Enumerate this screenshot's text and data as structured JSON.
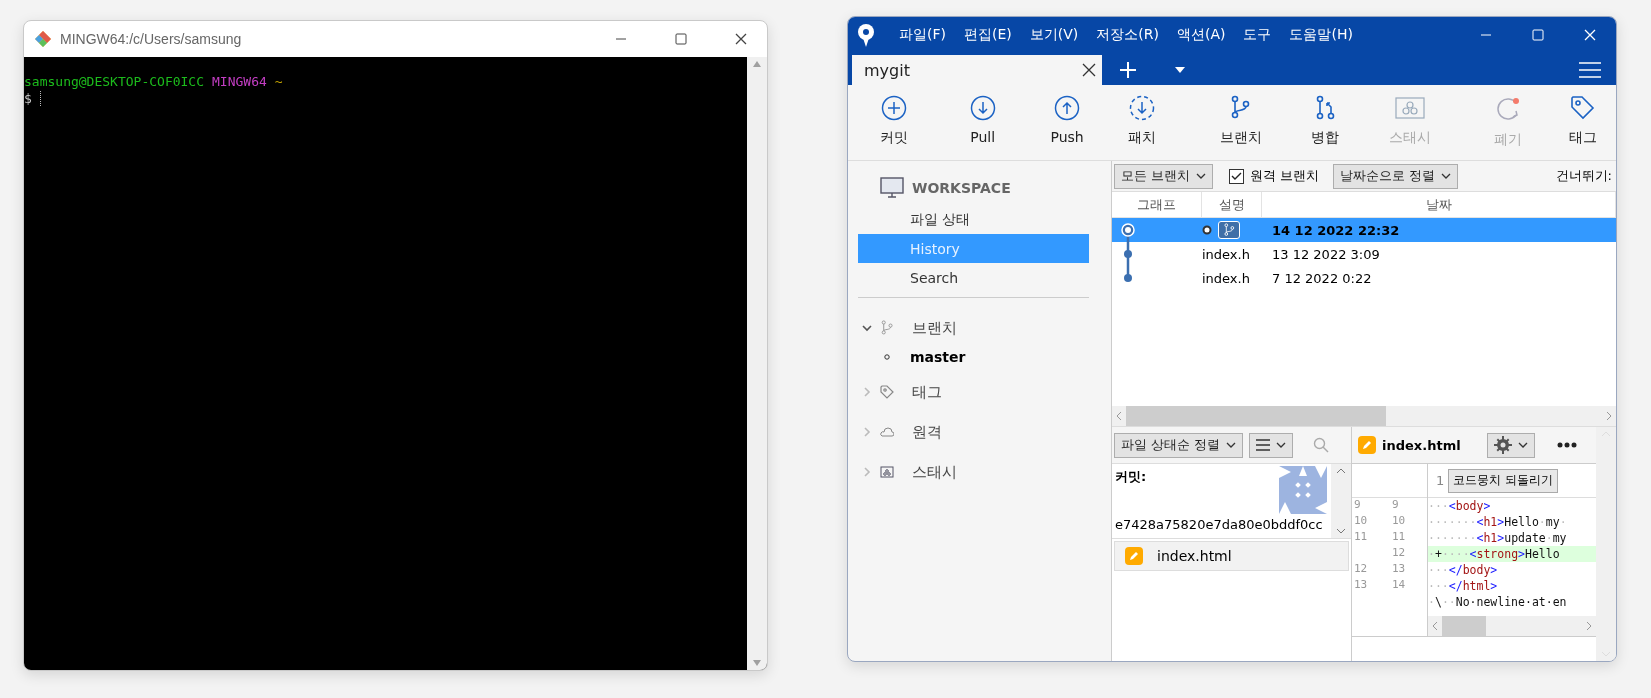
{
  "terminal": {
    "title": "MINGW64:/c/Users/samsung",
    "lines": [
      {
        "parts": [
          {
            "text": "samsung@DESKTOP-COF0ICC",
            "kind": "user"
          },
          {
            "text": "MINGW64",
            "kind": "system"
          },
          {
            "text": "~",
            "kind": "path"
          }
        ]
      },
      {
        "parts": [
          {
            "text": "$",
            "kind": "plain"
          }
        ],
        "cursor": true
      }
    ]
  },
  "sourcetree": {
    "menu": [
      "파일(F)",
      "편집(E)",
      "보기(V)",
      "저장소(R)",
      "액션(A)",
      "도구",
      "도움말(H)"
    ],
    "tabs": [
      {
        "label": "mygit",
        "selected": true
      }
    ],
    "toolbar": [
      {
        "label": "커밋",
        "kind": "commit",
        "disabled": false
      },
      {
        "label": "Pull",
        "kind": "pull",
        "disabled": false
      },
      {
        "label": "Push",
        "kind": "push",
        "disabled": false
      },
      {
        "label": "패치",
        "kind": "fetch",
        "disabled": false
      },
      {
        "label": "브랜치",
        "kind": "branch",
        "disabled": false
      },
      {
        "label": "병합",
        "kind": "merge",
        "disabled": false
      },
      {
        "label": "스태시",
        "kind": "stash",
        "disabled": true
      },
      {
        "label": "폐기",
        "kind": "discard",
        "disabled": true
      },
      {
        "label": "태그",
        "kind": "tag",
        "disabled": false
      }
    ],
    "sidebar": {
      "workspace": "WORKSPACE",
      "items": [
        {
          "label": "파일 상태",
          "selected": false
        },
        {
          "label": "History",
          "selected": true
        },
        {
          "label": "Search",
          "selected": false
        }
      ],
      "groups": [
        {
          "label": "브랜치",
          "kind": "branch",
          "expanded": true,
          "children": [
            {
              "label": "master",
              "current": true
            }
          ]
        },
        {
          "label": "태그",
          "kind": "tag",
          "expanded": false
        },
        {
          "label": "원격",
          "kind": "remote",
          "expanded": false
        },
        {
          "label": "스태시",
          "kind": "stash",
          "expanded": false
        }
      ]
    },
    "history": {
      "branch_filter": "모든 브랜치",
      "remote_branches": {
        "label": "원격 브랜치",
        "checked": true
      },
      "sort": "날짜순으로 정렬",
      "jump": "건너뛰기:",
      "columns": [
        "그래프",
        "설명",
        "날짜"
      ],
      "rows": [
        {
          "head": true,
          "branch_badge": true,
          "description": "",
          "date": "14 12 2022 22:32",
          "selected": true
        },
        {
          "head": false,
          "branch_badge": false,
          "description": "index.h",
          "date": "13 12 2022 3:09",
          "selected": false
        },
        {
          "head": false,
          "branch_badge": false,
          "description": "index.h",
          "date": "7 12 2022 0:22",
          "selected": false
        }
      ]
    },
    "files": {
      "sort": "파일 상태순 정렬",
      "commit_label": "커밋:",
      "hash": "e7428a75820e7da80e0bddf0cc",
      "items": [
        {
          "name": "index.html",
          "selected": true
        }
      ]
    },
    "diff": {
      "file": "index.html",
      "hunk": "1",
      "revert": "코드뭉치 되돌리기",
      "lines": [
        {
          "old": "9",
          "new": "9",
          "kind": "context",
          "parts": [
            {
              "text": "···",
              "kind": "ws"
            },
            {
              "text": "<",
              "kind": "br"
            },
            {
              "text": "body",
              "kind": "tag"
            },
            {
              "text": ">",
              "kind": "br"
            }
          ]
        },
        {
          "old": "10",
          "new": "10",
          "kind": "context",
          "parts": [
            {
              "text": "·······",
              "kind": "ws"
            },
            {
              "text": "<",
              "kind": "br"
            },
            {
              "text": "h1",
              "kind": "tag"
            },
            {
              "text": ">",
              "kind": "br"
            },
            {
              "text": "Hello",
              "kind": "text"
            },
            {
              "text": "·",
              "kind": "ws"
            },
            {
              "text": "my",
              "kind": "text"
            },
            {
              "text": "·",
              "kind": "ws"
            }
          ]
        },
        {
          "old": "11",
          "new": "11",
          "kind": "context",
          "parts": [
            {
              "text": "·······",
              "kind": "ws"
            },
            {
              "text": "<",
              "kind": "br"
            },
            {
              "text": "h1",
              "kind": "tag"
            },
            {
              "text": ">",
              "kind": "br"
            },
            {
              "text": "update",
              "kind": "text"
            },
            {
              "text": "·",
              "kind": "ws"
            },
            {
              "text": "my",
              "kind": "text"
            }
          ]
        },
        {
          "new": "12",
          "kind": "added",
          "parts": [
            {
              "text": "·",
              "kind": "ws"
            },
            {
              "text": "+",
              "kind": "text"
            },
            {
              "text": "····",
              "kind": "ws"
            },
            {
              "text": "<",
              "kind": "br"
            },
            {
              "text": "strong",
              "kind": "tag"
            },
            {
              "text": ">",
              "kind": "br"
            },
            {
              "text": "Hello",
              "kind": "text"
            }
          ]
        },
        {
          "old": "12",
          "new": "13",
          "kind": "context",
          "parts": [
            {
              "text": "···",
              "kind": "ws"
            },
            {
              "text": "</",
              "kind": "br"
            },
            {
              "text": "body",
              "kind": "tag"
            },
            {
              "text": ">",
              "kind": "br"
            }
          ]
        },
        {
          "old": "13",
          "new": "14",
          "kind": "context",
          "parts": [
            {
              "text": "···",
              "kind": "ws"
            },
            {
              "text": "</",
              "kind": "br"
            },
            {
              "text": "html",
              "kind": "tag"
            },
            {
              "text": ">",
              "kind": "br"
            }
          ]
        },
        {
          "kind": "context",
          "parts": [
            {
              "text": "·",
              "kind": "ws"
            },
            {
              "text": "\\",
              "kind": "text"
            },
            {
              "text": "··",
              "kind": "ws"
            },
            {
              "text": "No·newline·at·en",
              "kind": "text"
            }
          ]
        }
      ]
    }
  }
}
